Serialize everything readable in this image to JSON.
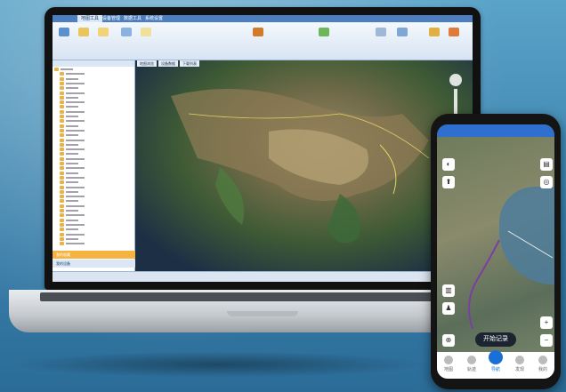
{
  "laptop_app": {
    "ribbon_tabs": [
      {
        "label": "地图工具",
        "active": true
      },
      {
        "label": "设备管理",
        "active": false
      },
      {
        "label": "数据工具",
        "active": false
      },
      {
        "label": "系统设置",
        "active": false
      }
    ],
    "map_tabs": [
      "地图浏览",
      "设备数据",
      "下载列表"
    ],
    "sidebar_sections": [
      {
        "label": "我的收藏",
        "active": true
      },
      {
        "label": "我的设备",
        "active": false
      }
    ],
    "tree_root": "全国"
  },
  "phone_app": {
    "record_button": "开始记录",
    "nav": [
      {
        "label": "地图",
        "active": false
      },
      {
        "label": "轨迹",
        "active": false
      },
      {
        "label": "导航",
        "active": true
      },
      {
        "label": "发现",
        "active": false
      },
      {
        "label": "我的",
        "active": false
      }
    ]
  },
  "colors": {
    "accent": "#2f6fd0",
    "ribbon": "#4d7fc0",
    "background": "#3f86b0"
  }
}
